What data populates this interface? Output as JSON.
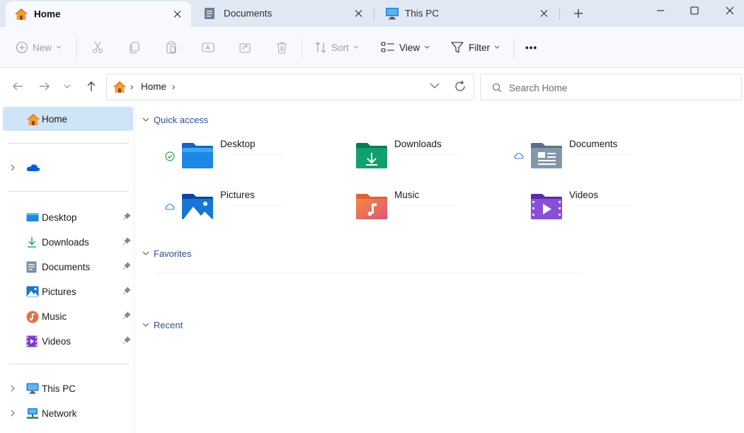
{
  "tabs": [
    {
      "label": "Home",
      "icon": "home-icon",
      "active": true
    },
    {
      "label": "Documents",
      "icon": "documents-icon",
      "active": false
    },
    {
      "label": "This PC",
      "icon": "pc-icon",
      "active": false
    }
  ],
  "commands": {
    "new": "New",
    "sort": "Sort",
    "view": "View",
    "filter": "Filter",
    "more": "•••"
  },
  "address": {
    "crumb": "Home",
    "separator": "›"
  },
  "search": {
    "placeholder": "Search Home"
  },
  "sidebar": {
    "home": "Home",
    "onedrive_label": "",
    "pinned": [
      {
        "label": "Desktop",
        "icon": "desktop-folder-icon"
      },
      {
        "label": "Downloads",
        "icon": "download-icon"
      },
      {
        "label": "Documents",
        "icon": "documents-icon"
      },
      {
        "label": "Pictures",
        "icon": "pictures-icon"
      },
      {
        "label": "Music",
        "icon": "music-icon"
      },
      {
        "label": "Videos",
        "icon": "videos-icon"
      }
    ],
    "drives": [
      {
        "label": "This PC",
        "icon": "pc-icon"
      },
      {
        "label": "Network",
        "icon": "network-icon"
      }
    ]
  },
  "sections": {
    "quick_access": "Quick access",
    "favorites": "Favorites",
    "recent": "Recent"
  },
  "quick_access": [
    {
      "name": "Desktop",
      "status": "synced"
    },
    {
      "name": "Downloads",
      "status": ""
    },
    {
      "name": "Documents",
      "status": "cloud"
    },
    {
      "name": "Pictures",
      "status": "cloud"
    },
    {
      "name": "Music",
      "status": ""
    },
    {
      "name": "Videos",
      "status": ""
    }
  ],
  "colors": {
    "tabbar_bg": "#dfe8f3",
    "selected_bg": "#cfe4f7",
    "section_text": "#2b4f8a",
    "synced_green": "#2e9e4f",
    "cloud_blue": "#2f7fd6"
  }
}
